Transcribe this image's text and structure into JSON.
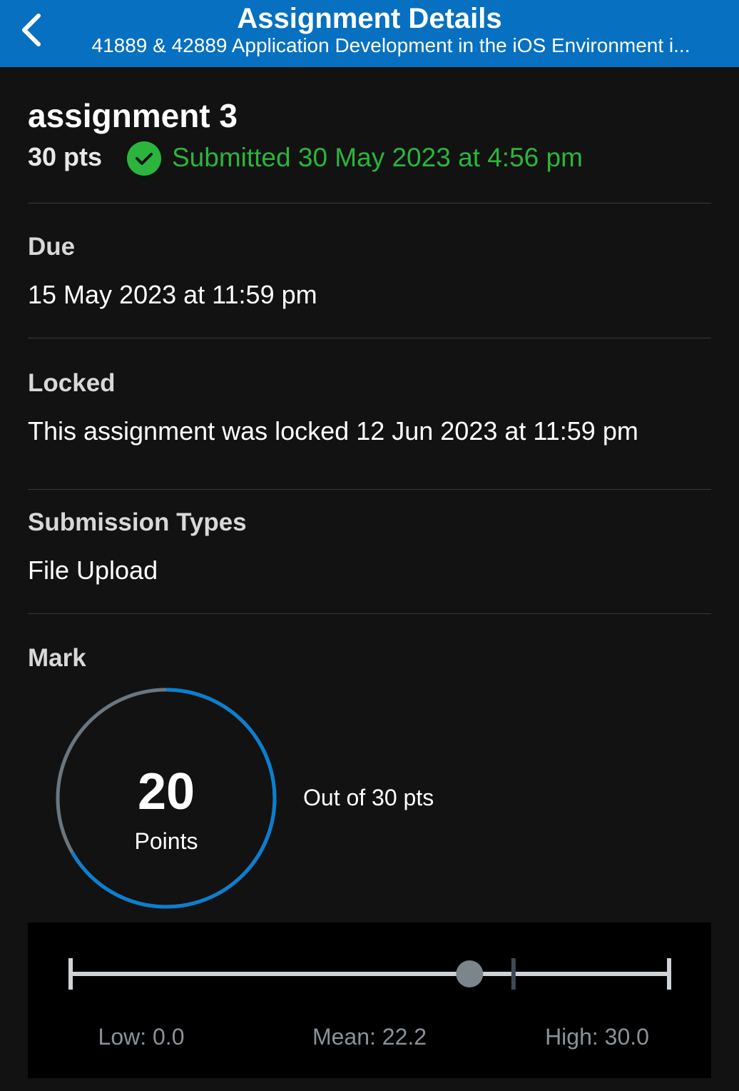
{
  "navbar": {
    "title": "Assignment Details",
    "subtitle": "41889 & 42889 Application Development in the iOS Environment i..."
  },
  "assignment": {
    "title": "assignment 3",
    "points": "30 pts",
    "submitted": "Submitted 30 May 2023 at 4:56 pm"
  },
  "due": {
    "label": "Due",
    "value": "15 May 2023 at 11:59 pm"
  },
  "locked": {
    "label": "Locked",
    "value": "This assignment was locked 12 Jun 2023 at 11:59 pm"
  },
  "submission_types": {
    "label": "Submission Types",
    "value": "File Upload"
  },
  "mark": {
    "label": "Mark",
    "score": "20",
    "score_unit": "Points",
    "out_of": "Out of 30 pts",
    "score_fraction": 0.6667
  },
  "stats": {
    "low_label": "Low: 0.0",
    "mean_label": "Mean: 22.2",
    "high_label": "High: 30.0",
    "low": 0.0,
    "mean": 22.2,
    "high": 30.0,
    "score": 20
  },
  "colors": {
    "navbar": "#0770c0",
    "submitted_green": "#2bb53d",
    "ring_progress": "#0a7fd1",
    "ring_track": "#6b767e"
  },
  "icons": {
    "back": "chevron-left-icon",
    "submitted": "check-circle-icon"
  }
}
